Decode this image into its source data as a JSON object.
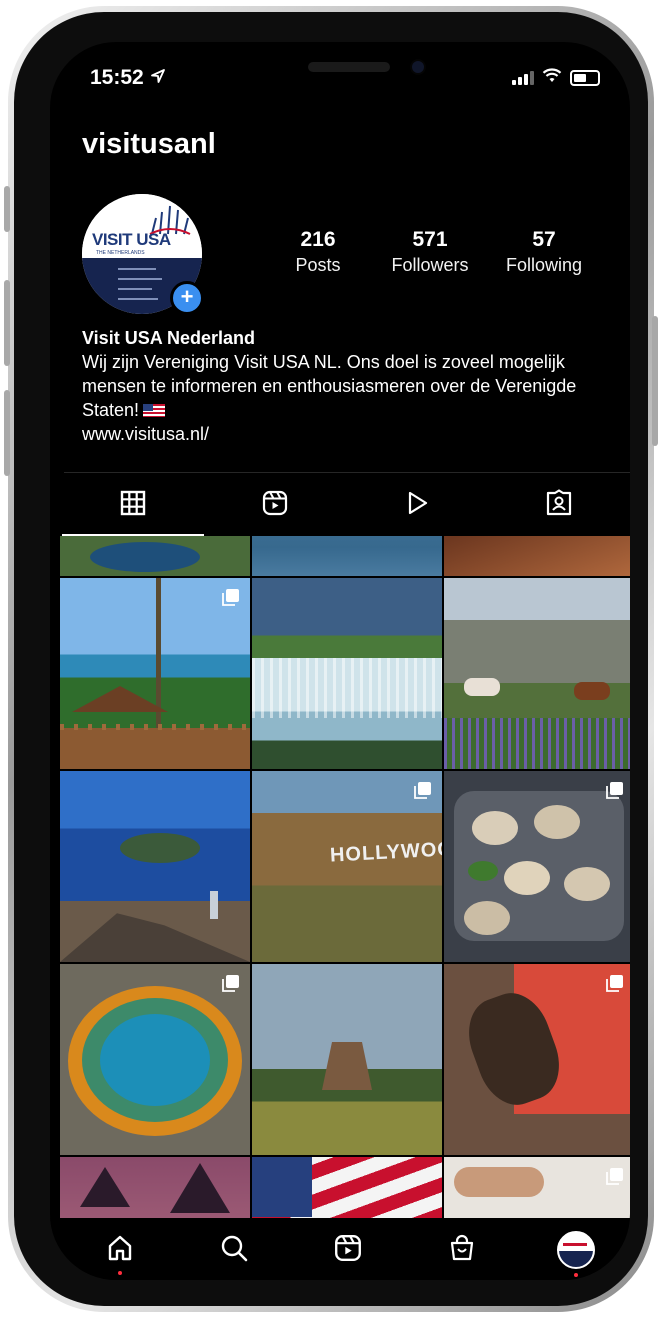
{
  "status_bar": {
    "time": "15:52"
  },
  "profile": {
    "username": "visitusanl",
    "avatar_logo": "VISIT USA",
    "avatar_sub": "THE NETHERLANDS",
    "stats": [
      {
        "value": "216",
        "label": "Posts"
      },
      {
        "value": "571",
        "label": "Followers"
      },
      {
        "value": "57",
        "label": "Following"
      }
    ],
    "display_name": "Visit USA Nederland",
    "bio": "Wij zijn Vereniging Visit USA NL. Ons doel is zoveel mogelijk mensen te informeren en enthousiasmeren over de Verenigde Staten!",
    "website": "www.visitusa.nl/"
  },
  "tile_overlay_text": "HOLLYWOOD",
  "colors": {
    "background": "#000000",
    "accent_blue": "#3a8ff0",
    "notification_red": "#ff2d3d"
  },
  "icons": [
    "grid-icon",
    "reels-icon",
    "play-icon",
    "tagged-icon",
    "home-icon",
    "search-icon",
    "reels-nav-icon",
    "shop-icon"
  ]
}
